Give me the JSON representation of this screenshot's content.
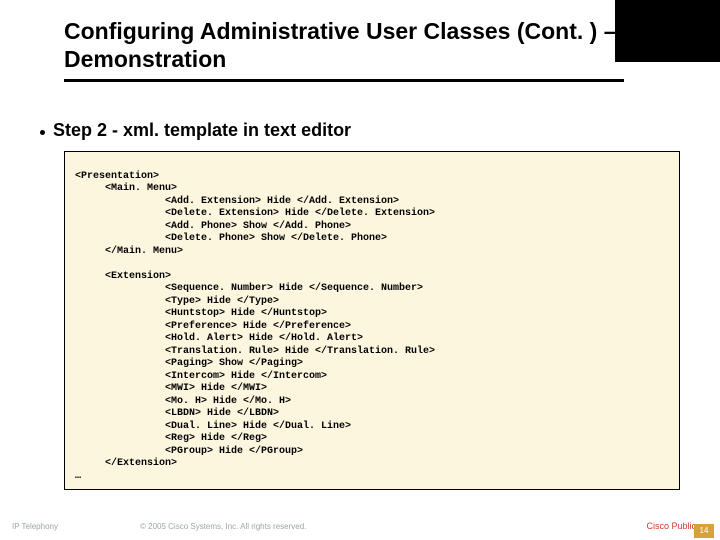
{
  "title": "Configuring Administrative User Classes (Cont. ) – Demonstration",
  "step": "Step 2 - xml. template in text editor",
  "code": {
    "l0": "<Presentation>",
    "l1": "<Main. Menu>",
    "l2": "<Add. Extension> Hide </Add. Extension>",
    "l3": "<Delete. Extension> Hide </Delete. Extension>",
    "l4": "<Add. Phone> Show </Add. Phone>",
    "l5": "<Delete. Phone> Show </Delete. Phone>",
    "l6": "</Main. Menu>",
    "l7": "<Extension>",
    "l8": "<Sequence. Number> Hide </Sequence. Number>",
    "l9": "<Type> Hide </Type>",
    "l10": "<Huntstop> Hide </Huntstop>",
    "l11": "<Preference> Hide </Preference>",
    "l12": "<Hold. Alert> Hide </Hold. Alert>",
    "l13": "<Translation. Rule> Hide </Translation. Rule>",
    "l14": "<Paging> Show </Paging>",
    "l15": "<Intercom> Hide </Intercom>",
    "l16": "<MWI> Hide </MWI>",
    "l17": "<Mo. H> Hide </Mo. H>",
    "l18": "<LBDN> Hide </LBDN>",
    "l19": "<Dual. Line> Hide </Dual. Line>",
    "l20": "<Reg> Hide </Reg>",
    "l21": "<PGroup> Hide </PGroup>",
    "l22": "</Extension>",
    "l23": "…"
  },
  "footer": {
    "left": "IP Telephony",
    "center": "© 2005 Cisco Systems, Inc. All rights reserved.",
    "cisco": "Cisco Public",
    "num": "14"
  }
}
